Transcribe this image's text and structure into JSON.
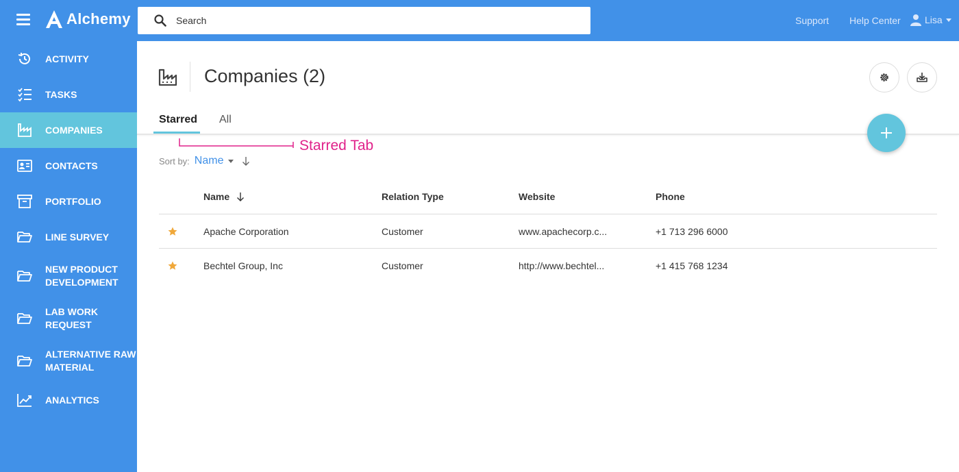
{
  "app": {
    "title": "Alchemy",
    "search_placeholder": "Search",
    "support_link": "Support",
    "help_link": "Help Center",
    "user_name": "Lisa"
  },
  "sidebar": {
    "items": [
      {
        "label": "ACTIVITY",
        "icon": "history-icon",
        "active": false
      },
      {
        "label": "TASKS",
        "icon": "checklist-icon",
        "active": false
      },
      {
        "label": "COMPANIES",
        "icon": "factory-icon",
        "active": true
      },
      {
        "label": "CONTACTS",
        "icon": "contact-card-icon",
        "active": false
      },
      {
        "label": "PORTFOLIO",
        "icon": "archive-box-icon",
        "active": false
      },
      {
        "label": "LINE SURVEY",
        "icon": "folder-open-icon",
        "active": false
      },
      {
        "label": "NEW PRODUCT\nDEVELOPMENT",
        "icon": "folder-open-icon",
        "active": false
      },
      {
        "label": "LAB WORK\nREQUEST",
        "icon": "folder-open-icon",
        "active": false
      },
      {
        "label": "ALTERNATIVE RAW\nMATERIAL",
        "icon": "folder-open-icon",
        "active": false
      },
      {
        "label": "ANALYTICS",
        "icon": "line-chart-icon",
        "active": false
      }
    ]
  },
  "page": {
    "title": "Companies (2)",
    "tabs": [
      {
        "label": "Starred",
        "active": true
      },
      {
        "label": "All",
        "active": false
      }
    ],
    "annotation": "Starred Tab",
    "sort_label": "Sort by:",
    "sort_value": "Name"
  },
  "table": {
    "columns": [
      "Name",
      "Relation Type",
      "Website",
      "Phone"
    ],
    "rows": [
      {
        "name": "Apache Corporation",
        "relation": "Customer",
        "website": "www.apachecorp.c...",
        "phone": "+1 713 296 6000",
        "starred": true
      },
      {
        "name": "Bechtel Group, Inc",
        "relation": "Customer",
        "website": "http://www.bechtel...",
        "phone": "+1 415 768 1234",
        "starred": true
      }
    ]
  },
  "colors": {
    "primary": "#4191e8",
    "accent": "#62c5dd",
    "annotation": "#e0218a",
    "star": "#f0a83a"
  }
}
